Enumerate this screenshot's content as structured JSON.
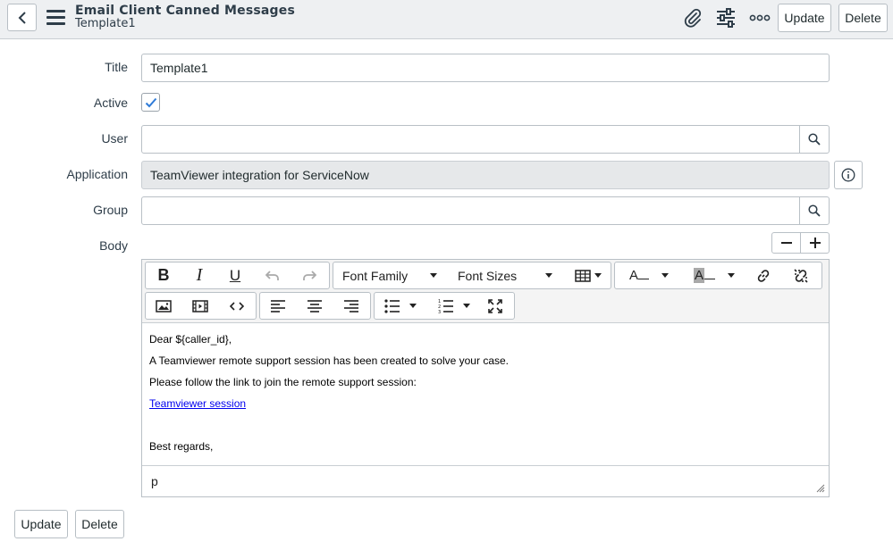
{
  "header": {
    "title": "Email Client Canned Messages",
    "subtitle": "Template1",
    "icons": [
      "chevron-left-icon",
      "hamburger-menu-icon",
      "paperclip-icon",
      "sliders-icon",
      "more-icon"
    ],
    "update_label": "Update",
    "delete_label": "Delete"
  },
  "form": {
    "title_label": "Title",
    "title_value": "Template1",
    "active_label": "Active",
    "active_checked": true,
    "user_label": "User",
    "user_value": "",
    "application_label": "Application",
    "application_value": "TeamViewer integration for ServiceNow",
    "group_label": "Group",
    "group_value": "",
    "body_label": "Body"
  },
  "editor": {
    "font_family_label": "Font Family",
    "font_sizes_label": "Font Sizes",
    "toolbar_icons": [
      "bold-icon",
      "italic-icon",
      "underline-icon",
      "undo-icon",
      "redo-icon",
      "table-icon",
      "text-color-icon",
      "background-color-icon",
      "link-icon",
      "unlink-icon",
      "image-icon",
      "video-icon",
      "code-icon",
      "align-left-icon",
      "align-center-icon",
      "align-right-icon",
      "bullet-list-icon",
      "numbered-list-icon",
      "fullscreen-icon"
    ],
    "content": {
      "line1": "Dear ${caller_id},",
      "line2": "A Teamviewer remote support session has been created to solve your case.",
      "line3": "Please follow the link to join the remote support session:",
      "link_text": "Teamviewer session",
      "line5": "Best regards,"
    },
    "status_path": "p"
  },
  "footer": {
    "update_label": "Update",
    "delete_label": "Delete"
  },
  "colors": {
    "header_bg": "#eef0f2",
    "readonly_bg": "#e6e8ea",
    "check_color": "#2f7bd8",
    "link_color": "#0000ee"
  }
}
